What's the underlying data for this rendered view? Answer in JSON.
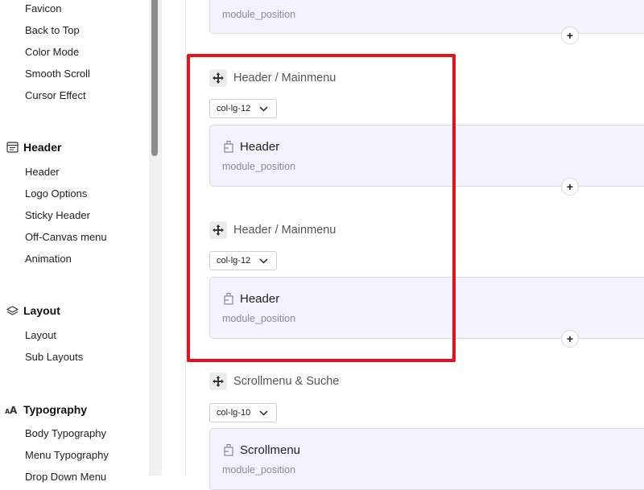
{
  "sidebar": {
    "top_items": [
      "Favicon",
      "Back to Top",
      "Color Mode",
      "Smooth Scroll",
      "Cursor Effect"
    ],
    "sections": [
      {
        "title": "Header",
        "icon": "header-icon",
        "items": [
          "Header",
          "Logo Options",
          "Sticky Header",
          "Off-Canvas menu",
          "Animation"
        ]
      },
      {
        "title": "Layout",
        "icon": "layers-icon",
        "items": [
          "Layout",
          "Sub Layouts"
        ]
      },
      {
        "title": "Typography",
        "icon": "typography-icon",
        "items": [
          "Body Typography",
          "Menu Typography",
          "Drop Down Menu"
        ]
      }
    ]
  },
  "main": {
    "top_card": {
      "subtitle": "module_position"
    },
    "rows": [
      {
        "title": "Header / Mainmenu",
        "column": "col-lg-12",
        "card_title": "Header",
        "card_subtitle": "module_position"
      },
      {
        "title": "Header / Mainmenu",
        "column": "col-lg-12",
        "card_title": "Header",
        "card_subtitle": "module_position"
      },
      {
        "title": "Scrollmenu & Suche",
        "column": "col-lg-10",
        "card_title": "Scrollmenu",
        "card_subtitle": "module_position"
      }
    ],
    "add_symbol": "+"
  },
  "colors": {
    "highlight": "#e2121b",
    "card_bg": "#f4f2fc",
    "scrollbar_thumb": "#8c8c8c"
  }
}
